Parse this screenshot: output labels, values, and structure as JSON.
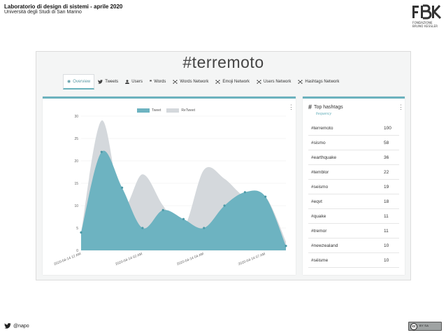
{
  "slide": {
    "title": "Laboratorio di design di sistemi - aprile 2020",
    "subtitle": "Università degli Studi di San Marino",
    "twitter_handle": "@napo"
  },
  "logo": {
    "line1": "FONDAZIONE",
    "line2": "BRUNO KESSLER"
  },
  "dashboard": {
    "title": "#terremoto",
    "tabs": [
      {
        "label": "Overview",
        "icon": "eye-icon",
        "active": true
      },
      {
        "label": "Tweets",
        "icon": "twitter-icon"
      },
      {
        "label": "Users",
        "icon": "user-icon"
      },
      {
        "label": "Words",
        "icon": "quote-icon"
      },
      {
        "label": "Words Network",
        "icon": "network-icon"
      },
      {
        "label": "Emoji Network",
        "icon": "network-icon"
      },
      {
        "label": "Users Network",
        "icon": "network-icon"
      },
      {
        "label": "Hashtags Network",
        "icon": "network-icon"
      }
    ]
  },
  "chart_data": {
    "type": "area",
    "x": [
      "2020-04-14 12 AM",
      "",
      "",
      "2020-04-14 02 AM",
      "",
      "",
      "2020-04-14 04 AM",
      "",
      "",
      "2020-04-14 07 AM",
      ""
    ],
    "series": [
      {
        "name": "Tweet",
        "color": "#6db3c1",
        "values": [
          4,
          22,
          14,
          5,
          9,
          7,
          5,
          10,
          13,
          12,
          1
        ]
      },
      {
        "name": "ReTweet",
        "color": "#d4d8dc",
        "values": [
          4,
          29,
          10,
          17,
          10,
          5,
          18,
          16,
          12,
          12,
          2
        ]
      }
    ],
    "ylim": [
      0,
      30
    ],
    "yticks": [
      0,
      5,
      10,
      15,
      20,
      25,
      30
    ],
    "grid": true,
    "legend": "top-center"
  },
  "hashtags": {
    "title": "Top hashtags",
    "subtitle": "frequency",
    "items": [
      {
        "tag": "#terremoto",
        "count": "100"
      },
      {
        "tag": "#sismo",
        "count": "58"
      },
      {
        "tag": "#earthquake",
        "count": "36"
      },
      {
        "tag": "#temblor",
        "count": "22"
      },
      {
        "tag": "#seismo",
        "count": "19"
      },
      {
        "tag": "#eqvt",
        "count": "18"
      },
      {
        "tag": "#quake",
        "count": "11"
      },
      {
        "tag": "#tremor",
        "count": "11"
      },
      {
        "tag": "#newzealand",
        "count": "10"
      },
      {
        "tag": "#séisme",
        "count": "10"
      }
    ]
  },
  "license": {
    "icon": "cc-icon",
    "mark": "cc",
    "text": "BY SA"
  }
}
